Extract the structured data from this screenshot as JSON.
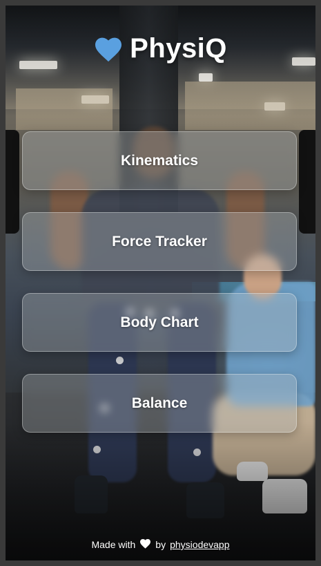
{
  "app": {
    "title": "PhysiQ",
    "logo_icon": "heart-icon",
    "logo_color": "#5aa0e0"
  },
  "menu": {
    "items": [
      {
        "label": "Kinematics"
      },
      {
        "label": "Force Tracker"
      },
      {
        "label": "Body Chart"
      },
      {
        "label": "Balance"
      }
    ]
  },
  "footer": {
    "prefix": "Made with",
    "icon": "heart-icon",
    "icon_color": "#ffffff",
    "by": "by",
    "link_text": "physiodevapp"
  }
}
